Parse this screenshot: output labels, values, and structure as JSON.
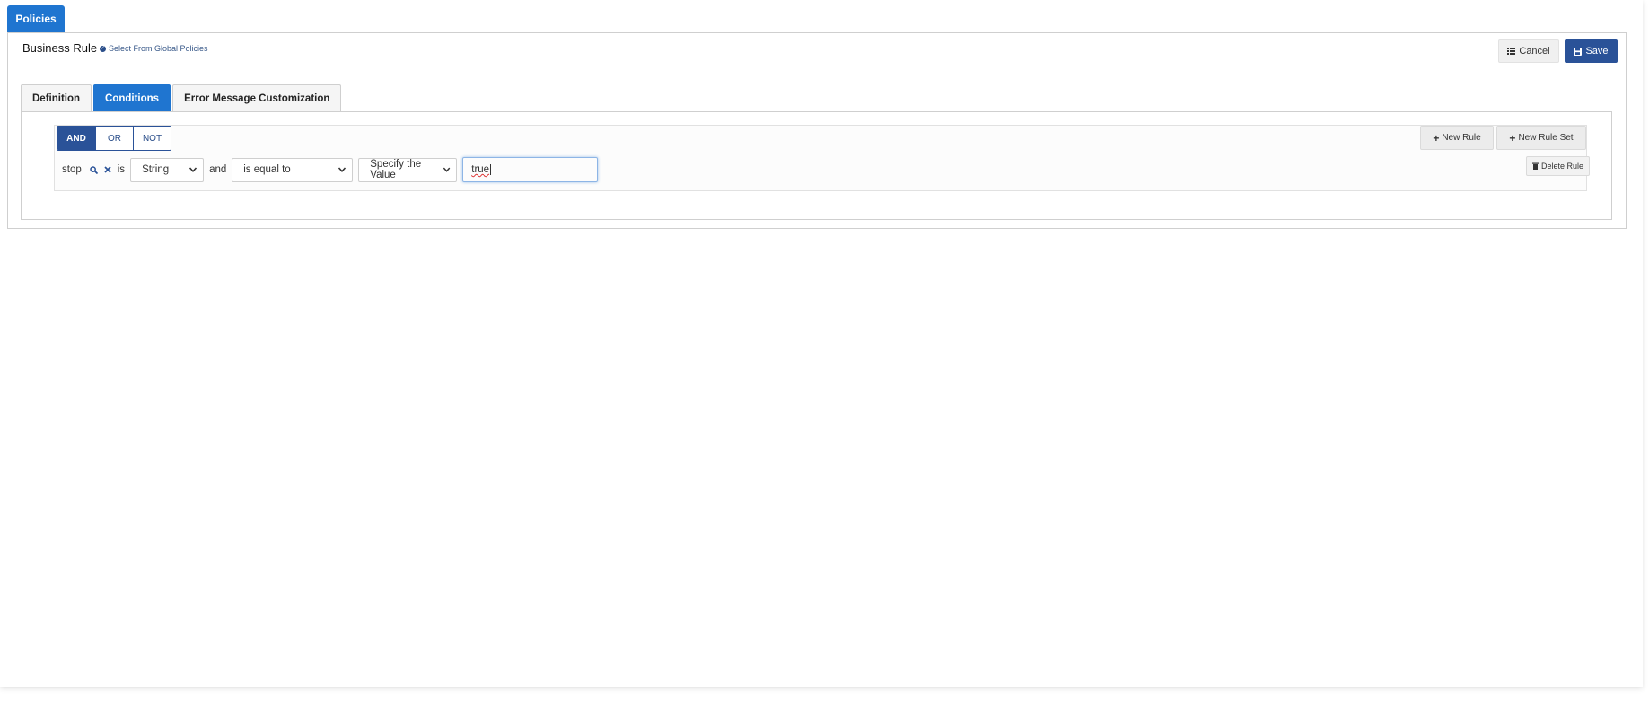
{
  "header": {
    "policies_tab": "Policies"
  },
  "panel": {
    "title": "Business Rule",
    "global_link": "Select From Global Policies",
    "cancel_label": "Cancel",
    "save_label": "Save"
  },
  "tabs": [
    {
      "label": "Definition",
      "active": false
    },
    {
      "label": "Conditions",
      "active": true
    },
    {
      "label": "Error Message Customization",
      "active": false
    }
  ],
  "conditions": {
    "logic_buttons": [
      {
        "label": "AND",
        "active": true
      },
      {
        "label": "OR",
        "active": false
      },
      {
        "label": "NOT",
        "active": false
      }
    ],
    "new_rule_label": "New Rule",
    "new_rule_set_label": "New Rule Set",
    "delete_rule_label": "Delete Rule",
    "rule": {
      "field": "stop",
      "is_word": "is",
      "type_select": "String",
      "and_word": "and",
      "operator_select": "is equal to",
      "value_mode_select": "Specify the Value",
      "value": "true"
    }
  },
  "colors": {
    "primary": "#1f75d0",
    "dark_primary": "#2a5298"
  },
  "icons": [
    "check-circle-icon",
    "list-icon",
    "floppy-disk-icon",
    "plus-icon",
    "search-icon",
    "close-icon",
    "chevron-down-icon",
    "trash-icon"
  ]
}
